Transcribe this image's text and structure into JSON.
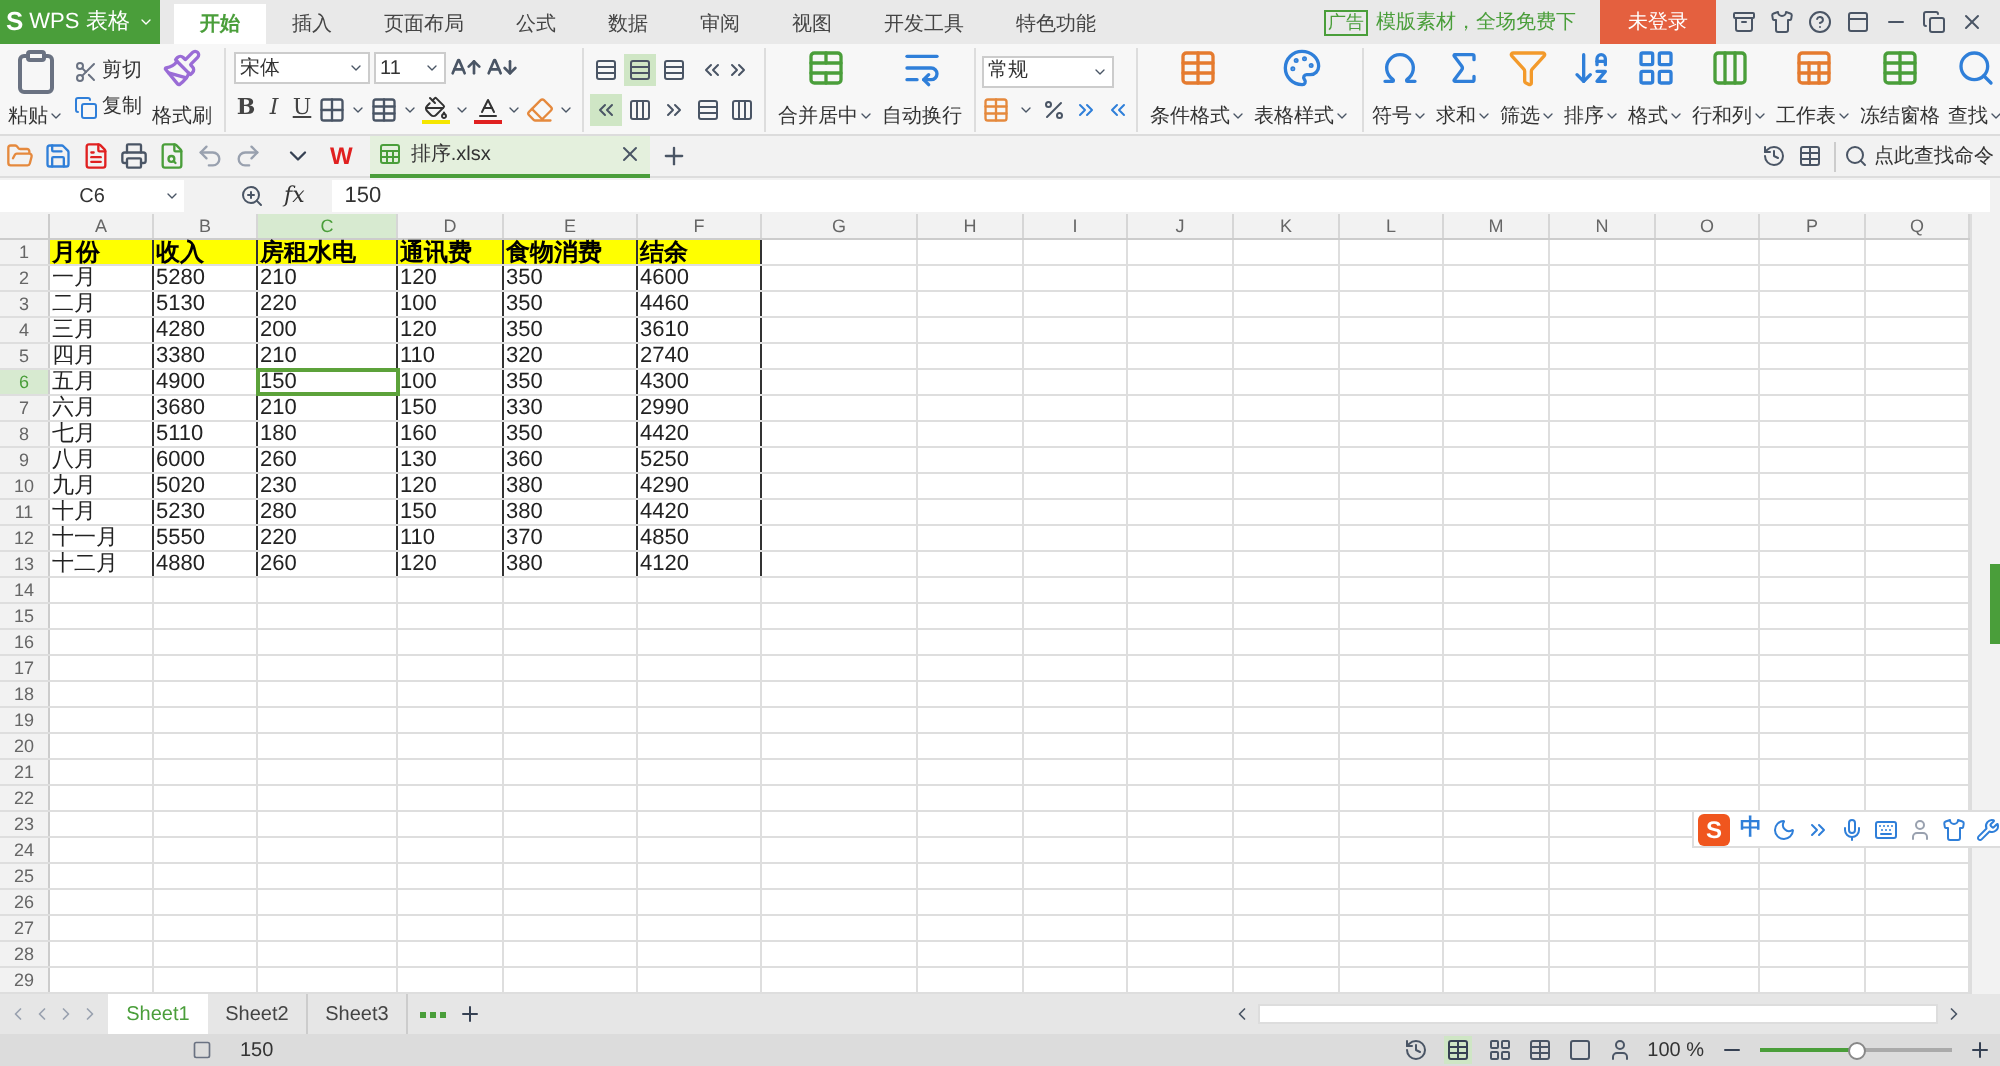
{
  "app": {
    "logo": "S",
    "title": "WPS 表格"
  },
  "menu_tabs": [
    {
      "label": "开始",
      "selected": true
    },
    {
      "label": "插入",
      "selected": false
    },
    {
      "label": "页面布局",
      "selected": false
    },
    {
      "label": "公式",
      "selected": false
    },
    {
      "label": "数据",
      "selected": false
    },
    {
      "label": "审阅",
      "selected": false
    },
    {
      "label": "视图",
      "selected": false
    },
    {
      "label": "开发工具",
      "selected": false
    },
    {
      "label": "特色功能",
      "selected": false
    }
  ],
  "ad": {
    "tag": "广告",
    "text": "模版素材，全场免费下"
  },
  "login_button": "未登录",
  "ribbon": {
    "clipboard": {
      "paste": "粘贴",
      "cut": "剪切",
      "copy": "复制",
      "format_painter": "格式刷"
    },
    "font": {
      "name": "宋体",
      "size": "11",
      "styles": [
        "B",
        "I",
        "U"
      ]
    },
    "vertical_align": [
      {
        "selected": false
      },
      {
        "selected": true
      },
      {
        "selected": false
      }
    ],
    "horizontal_align": [
      {
        "selected": true
      },
      {
        "selected": false
      },
      {
        "selected": false
      },
      {
        "selected": false
      },
      {
        "selected": false
      }
    ],
    "merge": {
      "label": "合并居中",
      "dropdown": true
    },
    "wrap": {
      "label": "自动换行",
      "dropdown": false
    },
    "number_format": "常规",
    "style_buttons": [
      {
        "label": "条件格式",
        "dropdown": true
      },
      {
        "label": "表格样式",
        "dropdown": true
      }
    ],
    "edit_buttons": [
      {
        "label": "符号",
        "dropdown": true
      },
      {
        "label": "求和",
        "dropdown": true
      },
      {
        "label": "筛选",
        "dropdown": true
      },
      {
        "label": "排序",
        "dropdown": true
      },
      {
        "label": "格式",
        "dropdown": true
      },
      {
        "label": "行和列",
        "dropdown": true
      },
      {
        "label": "工作表",
        "dropdown": true
      },
      {
        "label": "冻结窗格",
        "dropdown": false
      },
      {
        "label": "查找",
        "dropdown": true
      }
    ]
  },
  "quick_bar": {
    "docs_logo": "W",
    "document_tab": "排序.xlsx",
    "command_search": "点此查找命令"
  },
  "formula_bar": {
    "name_box": "C6",
    "fx": "fx",
    "value": "150"
  },
  "columns": [
    {
      "label": "A",
      "selected": false
    },
    {
      "label": "B",
      "selected": false
    },
    {
      "label": "C",
      "selected": true
    },
    {
      "label": "D",
      "selected": false
    },
    {
      "label": "E",
      "selected": false
    },
    {
      "label": "F",
      "selected": false
    },
    {
      "label": "G",
      "selected": false
    },
    {
      "label": "H",
      "selected": false
    },
    {
      "label": "I",
      "selected": false
    },
    {
      "label": "J",
      "selected": false
    },
    {
      "label": "K",
      "selected": false
    },
    {
      "label": "L",
      "selected": false
    },
    {
      "label": "M",
      "selected": false
    },
    {
      "label": "N",
      "selected": false
    },
    {
      "label": "O",
      "selected": false
    },
    {
      "label": "P",
      "selected": false
    },
    {
      "label": "Q",
      "selected": false
    }
  ],
  "row_headers": [
    {
      "label": "1",
      "selected": false
    },
    {
      "label": "2",
      "selected": false
    },
    {
      "label": "3",
      "selected": false
    },
    {
      "label": "4",
      "selected": false
    },
    {
      "label": "5",
      "selected": false
    },
    {
      "label": "6",
      "selected": true
    },
    {
      "label": "7",
      "selected": false
    },
    {
      "label": "8",
      "selected": false
    },
    {
      "label": "9",
      "selected": false
    },
    {
      "label": "10",
      "selected": false
    },
    {
      "label": "11",
      "selected": false
    },
    {
      "label": "12",
      "selected": false
    },
    {
      "label": "13",
      "selected": false
    },
    {
      "label": "14",
      "selected": false
    },
    {
      "label": "15",
      "selected": false
    },
    {
      "label": "16",
      "selected": false
    },
    {
      "label": "17",
      "selected": false
    },
    {
      "label": "18",
      "selected": false
    },
    {
      "label": "19",
      "selected": false
    },
    {
      "label": "20",
      "selected": false
    },
    {
      "label": "21",
      "selected": false
    },
    {
      "label": "22",
      "selected": false
    },
    {
      "label": "23",
      "selected": false
    },
    {
      "label": "24",
      "selected": false
    },
    {
      "label": "25",
      "selected": false
    },
    {
      "label": "26",
      "selected": false
    },
    {
      "label": "27",
      "selected": false
    },
    {
      "label": "28",
      "selected": false
    },
    {
      "label": "29",
      "selected": false
    }
  ],
  "table": {
    "header": [
      "月份",
      "收入",
      "房租水电",
      "通讯费",
      "食物消费",
      "结余"
    ],
    "rows": [
      [
        "一月",
        "5280",
        "210",
        "120",
        "350",
        "4600"
      ],
      [
        "二月",
        "5130",
        "220",
        "100",
        "350",
        "4460"
      ],
      [
        "三月",
        "4280",
        "200",
        "120",
        "350",
        "3610"
      ],
      [
        "四月",
        "3380",
        "210",
        "110",
        "320",
        "2740"
      ],
      [
        "五月",
        "4900",
        "150",
        "100",
        "350",
        "4300"
      ],
      [
        "六月",
        "3680",
        "210",
        "150",
        "330",
        "2990"
      ],
      [
        "七月",
        "5110",
        "180",
        "160",
        "350",
        "4420"
      ],
      [
        "八月",
        "6000",
        "260",
        "130",
        "360",
        "5250"
      ],
      [
        "九月",
        "5020",
        "230",
        "120",
        "380",
        "4290"
      ],
      [
        "十月",
        "5230",
        "280",
        "150",
        "380",
        "4420"
      ],
      [
        "十一月",
        "5550",
        "220",
        "110",
        "370",
        "4850"
      ],
      [
        "十二月",
        "4880",
        "260",
        "120",
        "380",
        "4120"
      ]
    ]
  },
  "sheet_tabs": [
    {
      "label": "Sheet1",
      "selected": true
    },
    {
      "label": "Sheet2",
      "selected": false
    },
    {
      "label": "Sheet3",
      "selected": false
    }
  ],
  "status_bar": {
    "value": "150",
    "zoom": "100 %",
    "zoom_level": {
      "level": 0.5
    }
  },
  "ime_bar": {
    "logo": "S",
    "mode": "中"
  }
}
